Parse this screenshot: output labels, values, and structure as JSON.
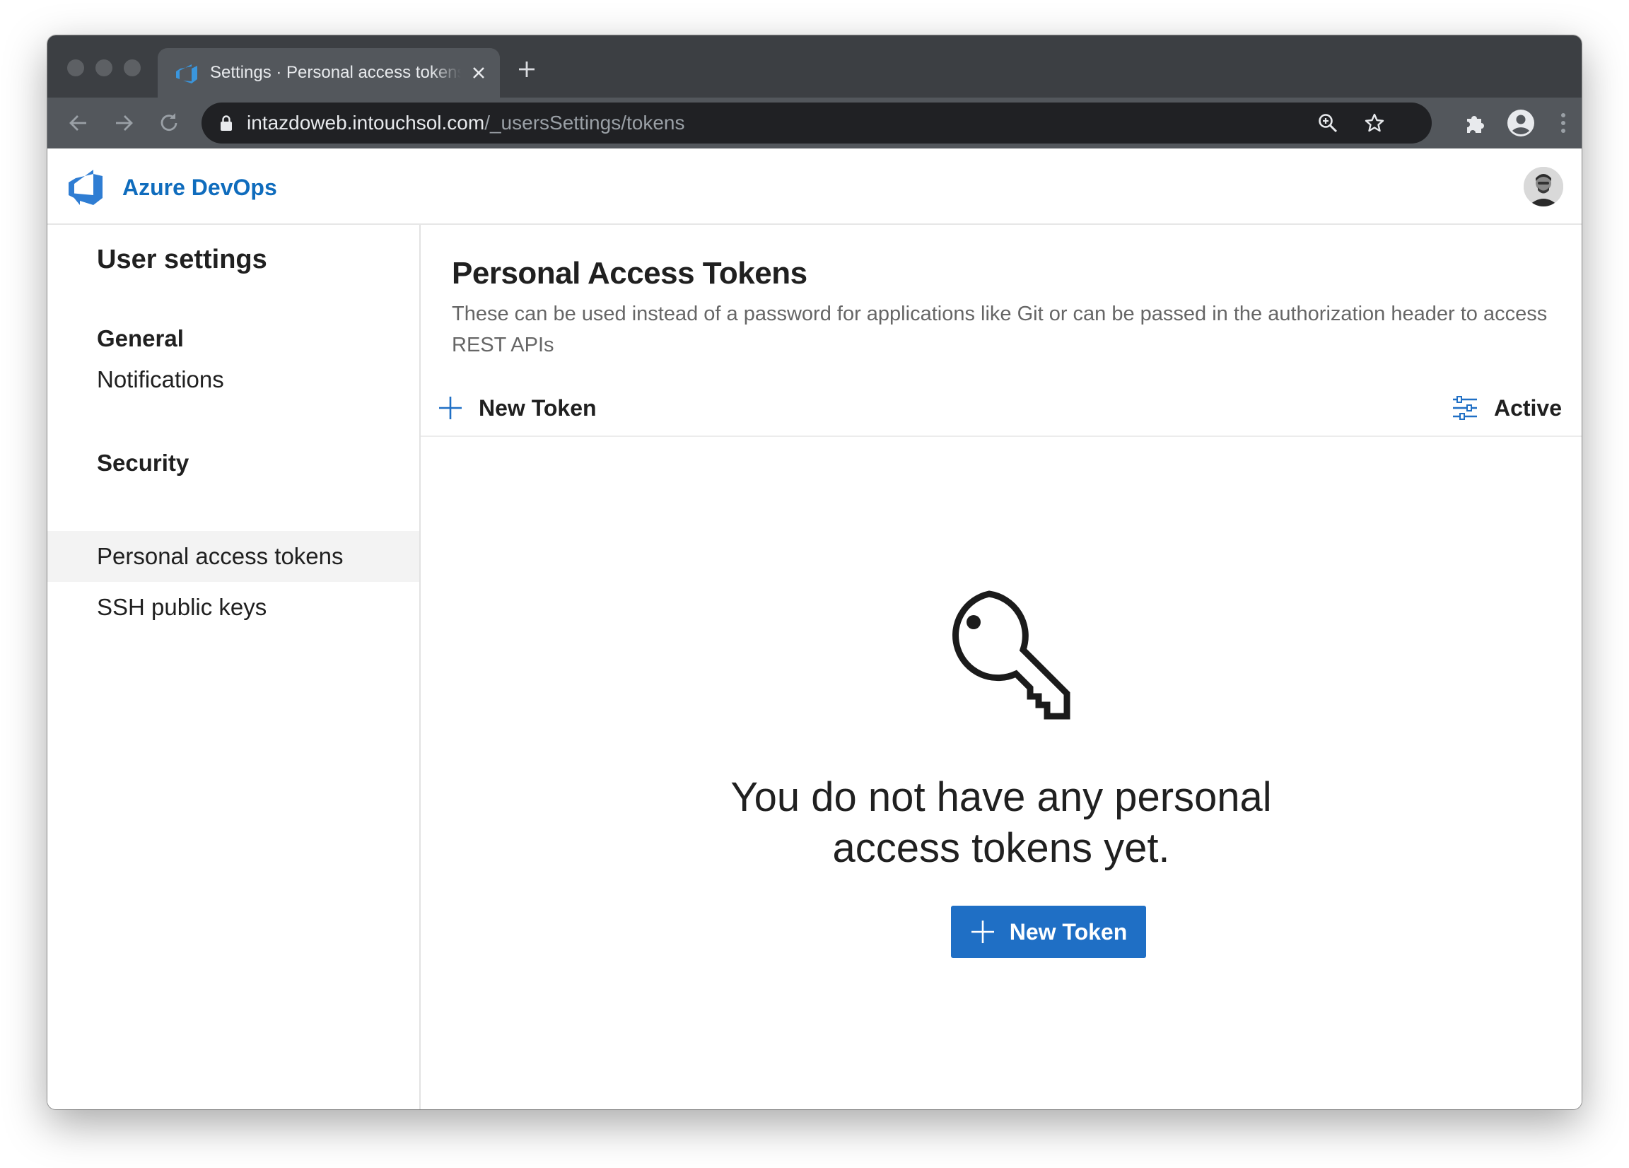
{
  "browser": {
    "tab_title": "Settings · Personal access tokens",
    "url_host": "intazdoweb.intouchsol.com",
    "url_path": "/_usersSettings/tokens"
  },
  "header": {
    "app_name": "Azure DevOps"
  },
  "sidebar": {
    "title": "User settings",
    "groups": [
      {
        "label": "General"
      },
      {
        "label": "Security"
      }
    ],
    "items": [
      {
        "label": "Notifications"
      },
      {
        "label": "Personal access tokens",
        "selected": true
      },
      {
        "label": "SSH public keys"
      }
    ]
  },
  "main": {
    "title": "Personal Access Tokens",
    "description": "These can be used instead of a password for applications like Git or can be passed in the authorization header to access REST APIs",
    "new_token_label": "New Token",
    "filter_label": "Active",
    "empty_line1": "You do not have any personal",
    "empty_line2": "access tokens yet.",
    "empty_button_label": "New Token"
  },
  "colors": {
    "accent": "#1f6fc5",
    "brand_text": "#0f6cbd",
    "chrome_dark": "#3c3f43"
  },
  "icons": [
    "azure-devops-logo-icon",
    "lock-icon",
    "back-arrow-icon",
    "forward-arrow-icon",
    "reload-icon",
    "zoom-icon",
    "star-icon",
    "extensions-icon",
    "profile-icon",
    "more-icon",
    "plus-icon",
    "filter-icon",
    "key-icon",
    "close-icon"
  ]
}
